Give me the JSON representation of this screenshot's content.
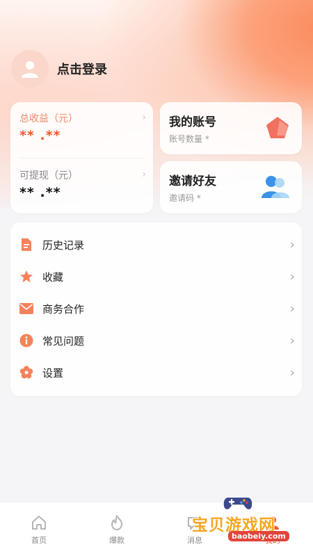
{
  "header": {
    "login_text": "点击登录",
    "avatar_icon": "user-avatar-icon"
  },
  "earnings": {
    "total_label": "总收益（元）",
    "total_value": "** .**",
    "withdraw_label": "可提现（元）",
    "withdraw_value": "** .**",
    "chevron": "›"
  },
  "account_card": {
    "title": "我的账号",
    "subtitle": "账号数量 *",
    "icon": "pentagon-badge-icon"
  },
  "invite_card": {
    "title": "邀请好友",
    "subtitle": "邀请码 *",
    "icon": "people-icon"
  },
  "menu": {
    "items": [
      {
        "label": "历史记录",
        "icon": "document-icon"
      },
      {
        "label": "收藏",
        "icon": "star-icon"
      },
      {
        "label": "商务合作",
        "icon": "mail-icon"
      },
      {
        "label": "常见问题",
        "icon": "info-icon"
      },
      {
        "label": "设置",
        "icon": "settings-flower-icon"
      }
    ],
    "chevron": "›"
  },
  "tabbar": {
    "tabs": [
      {
        "label": "首页",
        "icon": "home-icon"
      },
      {
        "label": "爆款",
        "icon": "flame-icon"
      },
      {
        "label": "消息",
        "icon": "message-icon"
      },
      {
        "label": "我的",
        "icon": "profile-icon"
      }
    ],
    "active_index": 3
  },
  "watermark": {
    "title": "宝贝游戏网",
    "url": "baobeiy.com"
  },
  "colors": {
    "accent": "#f2572d",
    "accent_light": "#ee8a6a",
    "icon_orange": "#f4835b",
    "invite_blue": "#4aa8f0"
  }
}
